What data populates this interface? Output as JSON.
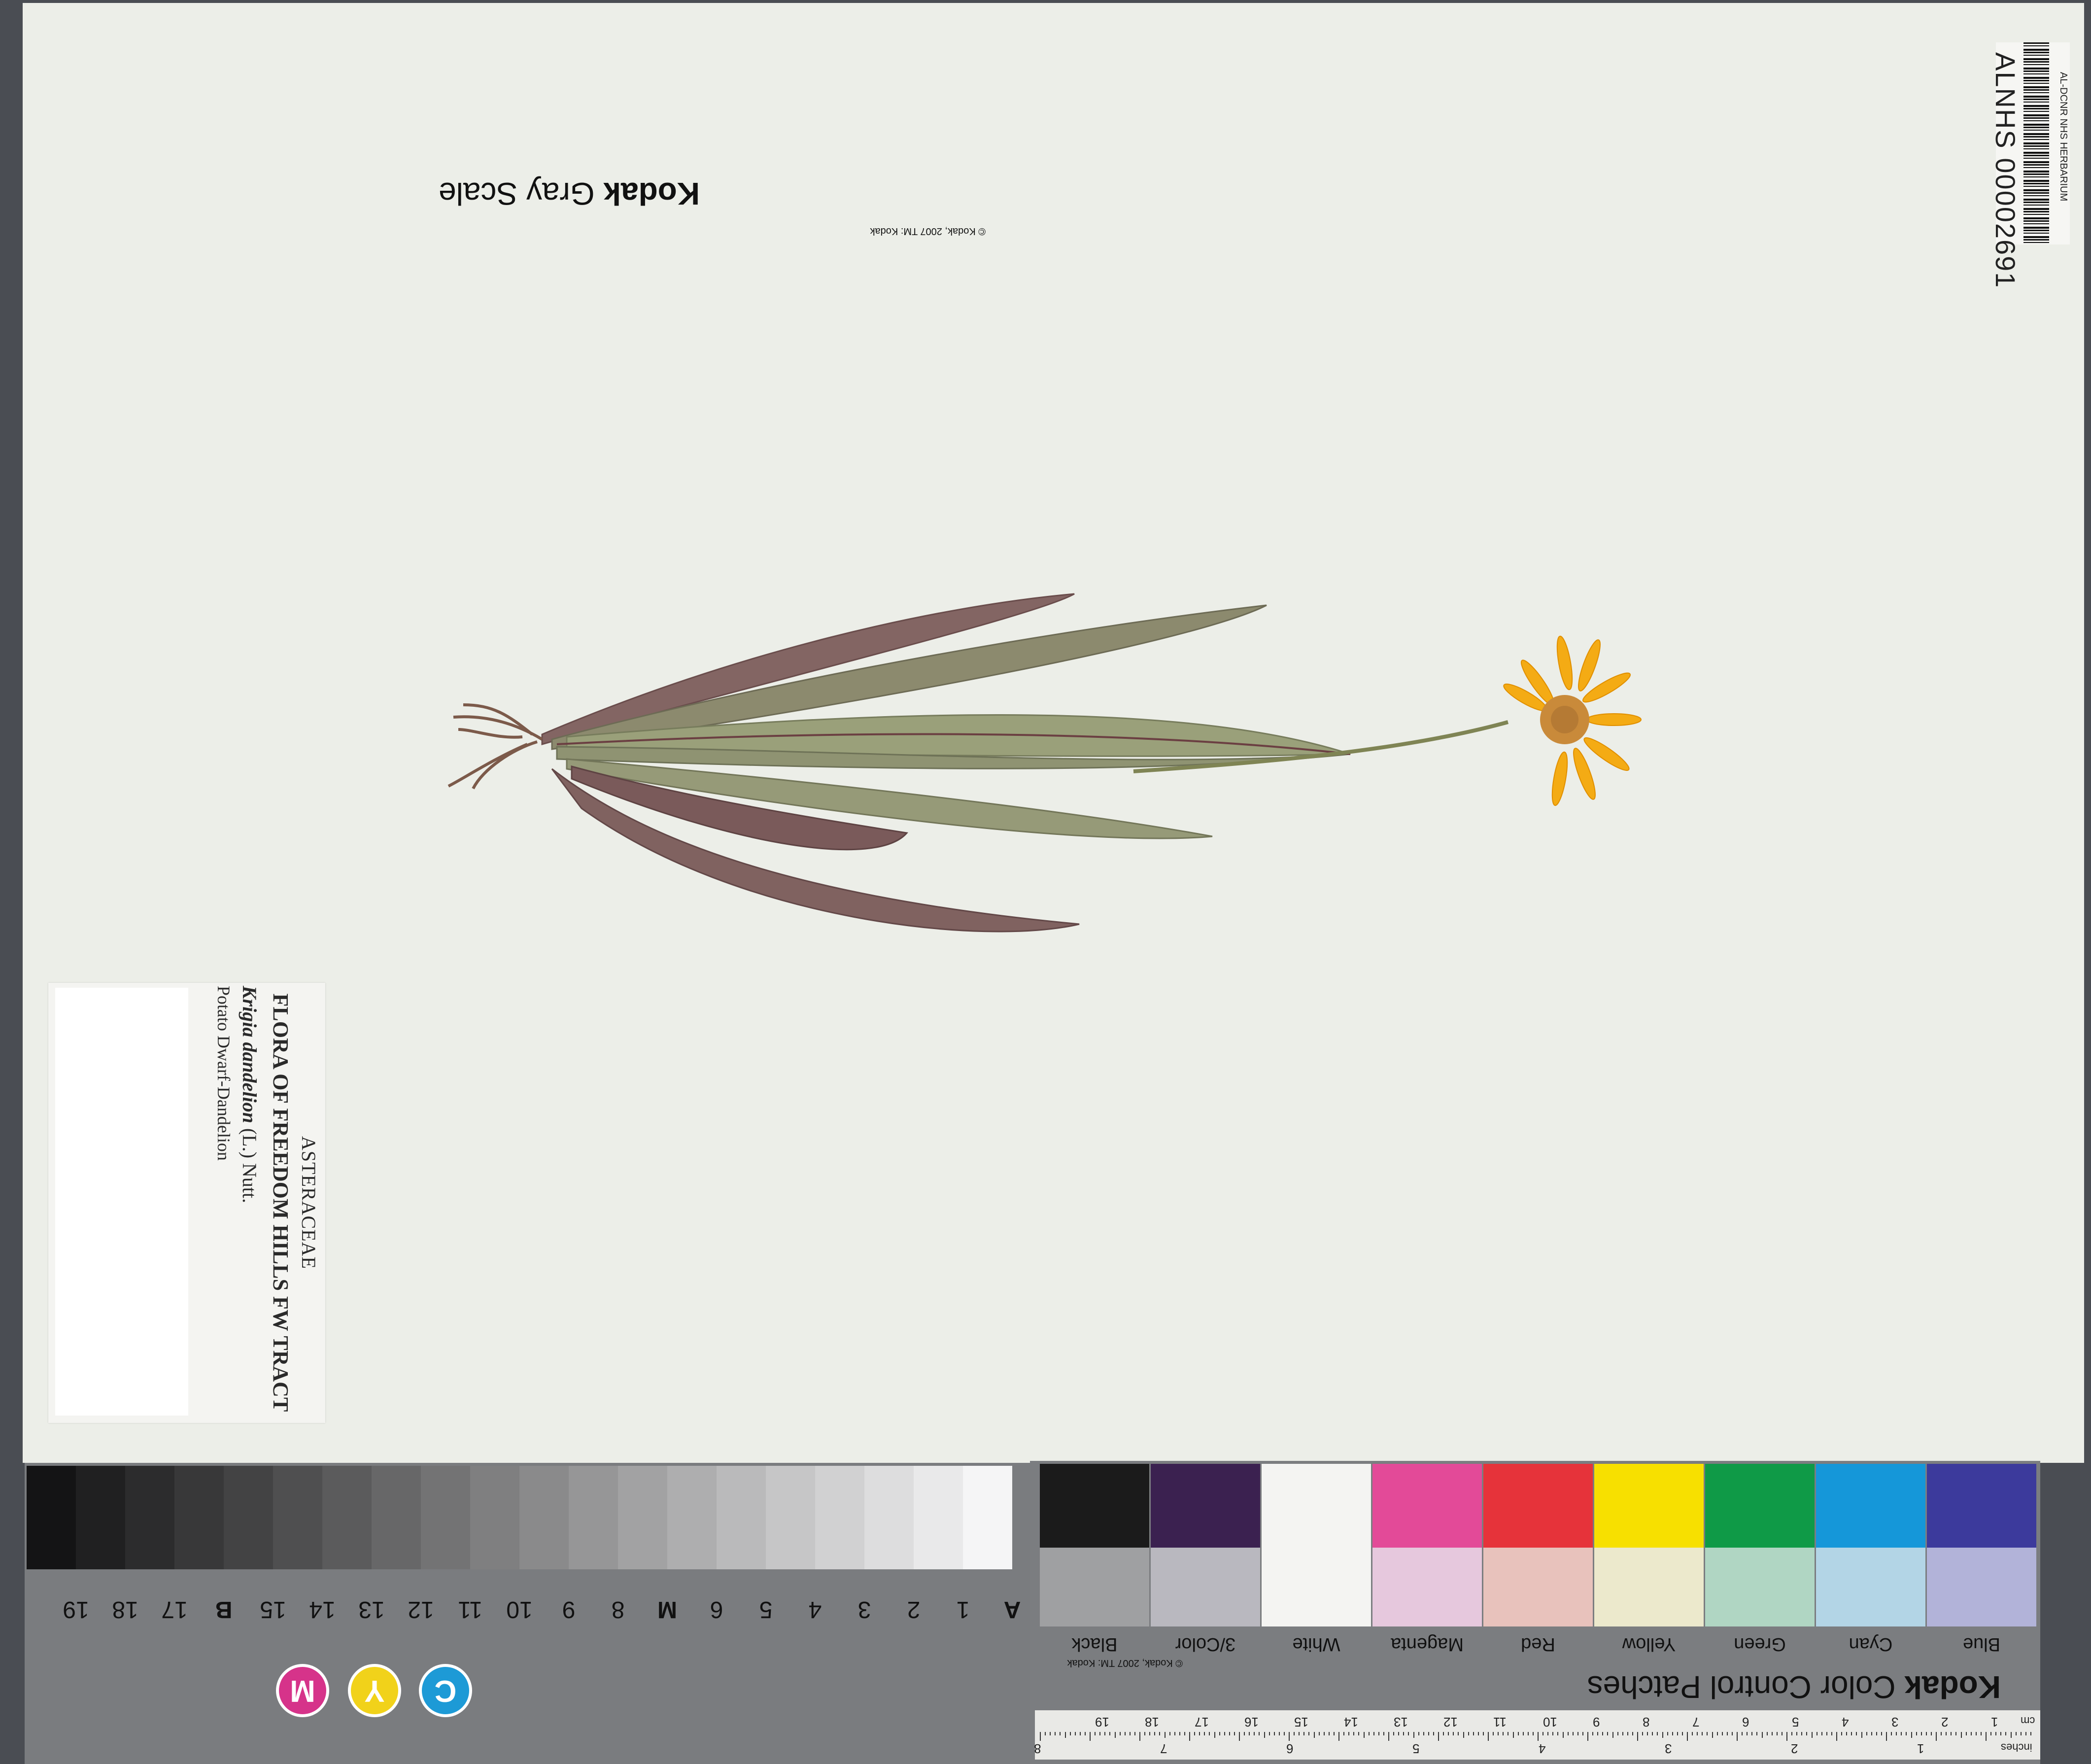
{
  "barcode": {
    "number": "ALNHS 00002691",
    "institution": "AL-DCNR NHS HERBARIUM"
  },
  "label": {
    "family": "ASTERACEAE",
    "project": "FLORA OF FREEDOM HILLS FW TRACT",
    "genus_species": "Krigia dandelion",
    "authority": "(L.) Nutt.",
    "common_name": "Potato Dwarf-Dandelion"
  },
  "gray_scale": {
    "brand": "Kodak",
    "title": "Gray Scale",
    "copyright": "© Kodak, 2007 TM: Kodak",
    "labels": [
      "A",
      "1",
      "2",
      "3",
      "4",
      "5",
      "6",
      "M",
      "8",
      "9",
      "10",
      "11",
      "12",
      "13",
      "14",
      "15",
      "B",
      "17",
      "18",
      "19"
    ],
    "cmy": [
      "C",
      "Y",
      "M"
    ],
    "colors": {
      "cyan": "#1d9ad6",
      "yellow": "#f1d21a",
      "magenta": "#d6338a"
    }
  },
  "color_patches": {
    "brand": "Kodak",
    "title": "Color Control Patches",
    "copyright": "© Kodak, 2007 TM: Kodak",
    "patches": [
      {
        "name": "Blue",
        "top": "#3c3a9c",
        "bottom": "#b2b3d9"
      },
      {
        "name": "Cyan",
        "top": "#1597d9",
        "bottom": "#b3d5e6"
      },
      {
        "name": "Green",
        "top": "#0f9a47",
        "bottom": "#b0d6c3"
      },
      {
        "name": "Yellow",
        "top": "#f7e000",
        "bottom": "#ece9cc"
      },
      {
        "name": "Red",
        "top": "#e6333a",
        "bottom": "#e8c2bc"
      },
      {
        "name": "Magenta",
        "top": "#e34a98",
        "bottom": "#e6c8dd"
      },
      {
        "name": "White",
        "top": "#f4f4f2",
        "bottom": "#f4f4f2"
      },
      {
        "name": "3/Color",
        "top": "#3b2150",
        "bottom": "#b9b8bf"
      },
      {
        "name": "Black",
        "top": "#1b1b1b",
        "bottom": "#9fa0a2"
      }
    ],
    "ruler_cm": [
      "1",
      "2",
      "3",
      "4",
      "5",
      "6",
      "7",
      "8",
      "9",
      "10",
      "11",
      "12",
      "13",
      "14",
      "15",
      "16",
      "17",
      "18",
      "19"
    ],
    "ruler_inches": [
      "1",
      "2",
      "3",
      "4",
      "5",
      "6",
      "7",
      "8"
    ],
    "unit_cm": "cm",
    "unit_inches": "inches"
  }
}
